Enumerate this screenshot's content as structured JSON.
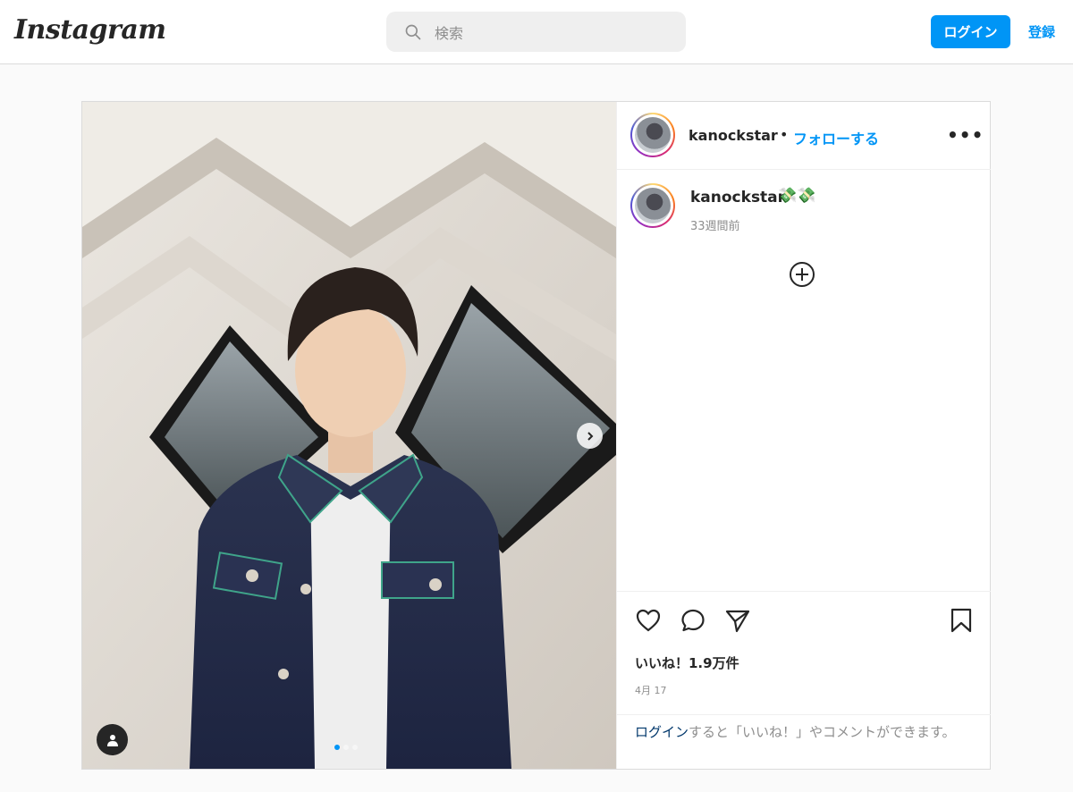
{
  "header": {
    "logo": "Instagram",
    "search_placeholder": "検索",
    "login_label": "ログイン",
    "register_label": "登録"
  },
  "post": {
    "username": "kanockstar",
    "separator": "•",
    "follow_label": "フォローする",
    "more_label": "•••",
    "caption_username": "kanockstar",
    "caption_text": "💸💸",
    "caption_time": "33週間前",
    "likes": "いいね！1.9万件",
    "date": "4月 17",
    "login_link": "ログイン",
    "login_prompt": "すると「いいね！」やコメントができます。",
    "carousel": {
      "total": 3,
      "current": 1
    }
  },
  "icons": {
    "search": "search-icon",
    "more": "more-options-icon",
    "add_comment": "plus-circle-icon",
    "like": "heart-icon",
    "comment": "comment-icon",
    "share": "paper-plane-icon",
    "save": "bookmark-icon",
    "next": "chevron-right-icon",
    "tagged_user": "user-icon"
  },
  "colors": {
    "accent": "#0095f6",
    "text": "#262626",
    "muted": "#8e8e8e",
    "link_dark": "#00376b",
    "border": "#dbdbdb",
    "page_bg": "#fafafa"
  }
}
